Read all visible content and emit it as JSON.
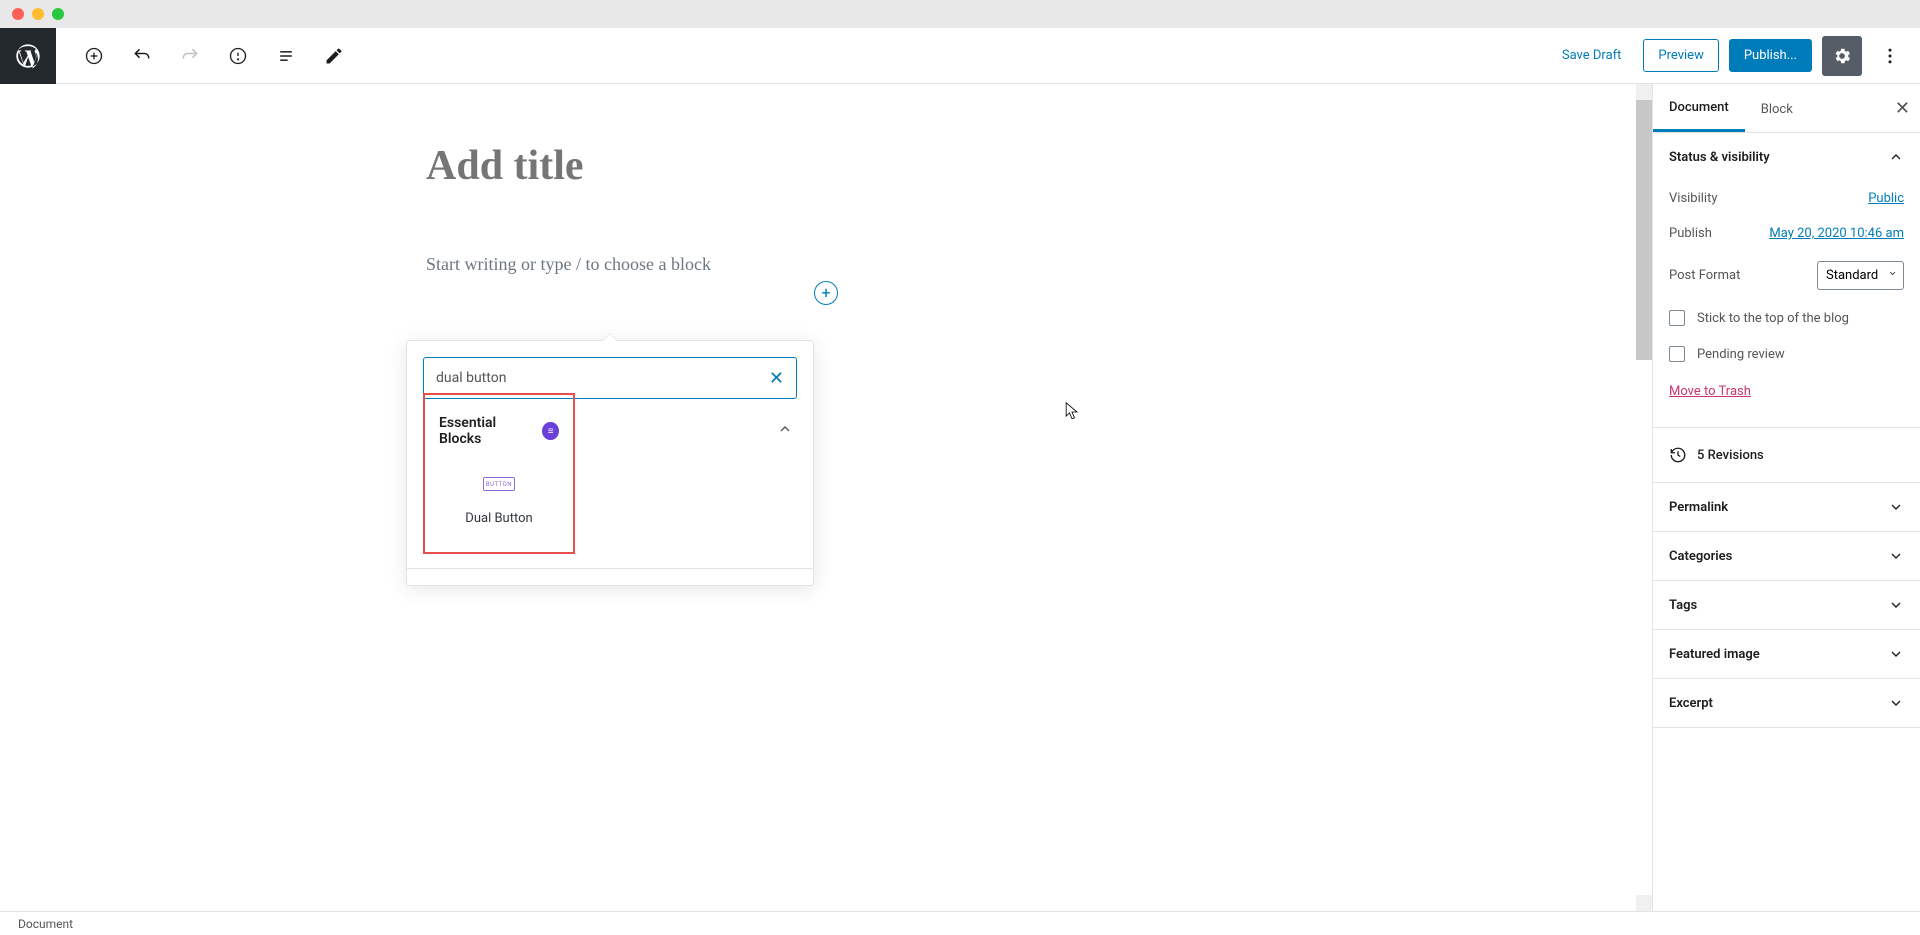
{
  "toolbar": {
    "save_draft": "Save Draft",
    "preview": "Preview",
    "publish": "Publish..."
  },
  "editor": {
    "title_placeholder": "Add title",
    "content_hint": "Start writing or type / to choose a block"
  },
  "inserter": {
    "search_value": "dual button",
    "section_title": "Essential Blocks",
    "block_label": "Dual Button",
    "block_icon_text": "BUTTON"
  },
  "sidebar": {
    "tabs": {
      "document": "Document",
      "block": "Block"
    },
    "status": {
      "title": "Status & visibility",
      "visibility_label": "Visibility",
      "visibility_value": "Public",
      "publish_label": "Publish",
      "publish_value": "May 20, 2020 10:46 am",
      "post_format_label": "Post Format",
      "post_format_value": "Standard",
      "stick_label": "Stick to the top of the blog",
      "pending_label": "Pending review",
      "trash": "Move to Trash"
    },
    "revisions": "5 Revisions",
    "panels": {
      "permalink": "Permalink",
      "categories": "Categories",
      "tags": "Tags",
      "featured": "Featured image",
      "excerpt": "Excerpt"
    }
  },
  "footer": {
    "breadcrumb": "Document"
  }
}
